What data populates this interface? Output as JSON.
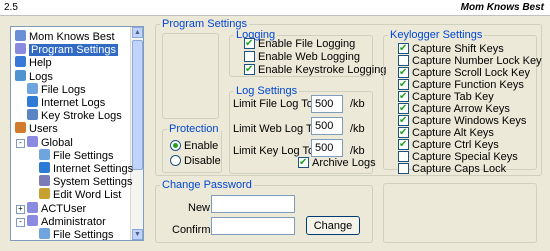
{
  "titlebar": {
    "version": "2.5",
    "app_name": "Mom Knows Best"
  },
  "tree": [
    {
      "label": "Mom Knows Best",
      "indent": 0,
      "icon": "home-icon",
      "color": "#6b8fd6"
    },
    {
      "label": "Program Settings",
      "indent": 0,
      "icon": "gear-icon",
      "color": "#8a8ae0",
      "selected": true
    },
    {
      "label": "Help",
      "indent": 0,
      "icon": "help-icon",
      "color": "#3a78d8"
    },
    {
      "label": "Logs",
      "indent": 0,
      "icon": "logs-icon",
      "color": "#4f93d1"
    },
    {
      "label": "File Logs",
      "indent": 1,
      "icon": "file-logs-icon",
      "color": "#6fa4df"
    },
    {
      "label": "Internet Logs",
      "indent": 1,
      "icon": "globe-icon",
      "color": "#2d7bd5"
    },
    {
      "label": "Key Stroke Logs",
      "indent": 1,
      "icon": "keyboard-icon",
      "color": "#5a87c4"
    },
    {
      "label": "Users",
      "indent": 0,
      "icon": "users-icon",
      "color": "#d07c2c"
    },
    {
      "label": "Global",
      "indent": 1,
      "icon": "gear-icon",
      "color": "#8a8ae0",
      "expander": "-"
    },
    {
      "label": "File Settings",
      "indent": 2,
      "icon": "file-settings-icon",
      "color": "#6fa4df"
    },
    {
      "label": "Internet Settings",
      "indent": 2,
      "icon": "globe-icon",
      "color": "#2d7bd5"
    },
    {
      "label": "System Settings",
      "indent": 2,
      "icon": "system-settings-icon",
      "color": "#7b7bb8"
    },
    {
      "label": "Edit Word List",
      "indent": 2,
      "icon": "pencil-icon",
      "color": "#c8a030"
    },
    {
      "label": "ACTUser",
      "indent": 1,
      "icon": "gear-icon",
      "color": "#8a8ae0",
      "expander": "+"
    },
    {
      "label": "Administrator",
      "indent": 1,
      "icon": "gear-icon",
      "color": "#8a8ae0",
      "expander": "-"
    },
    {
      "label": "File Settings",
      "indent": 2,
      "icon": "file-settings-icon",
      "color": "#6fa4df"
    }
  ],
  "program_settings": {
    "title": "Program Settings"
  },
  "logging": {
    "title": "Logging",
    "items": [
      {
        "label": "Enable File Logging",
        "checked": true
      },
      {
        "label": "Enable Web Logging",
        "checked": false
      },
      {
        "label": "Enable Keystroke Logging",
        "checked": true
      }
    ]
  },
  "log_settings": {
    "title": "Log Settings",
    "file_label": "Limit File Log To:",
    "file_value": "500",
    "file_unit": "/kb",
    "web_label": "Limit Web Log To:",
    "web_value": "500",
    "web_unit": "/kb",
    "key_label": "Limit Key Log To:",
    "key_value": "500",
    "key_unit": "/kb",
    "archive_label": "Archive Logs",
    "archive_checked": true
  },
  "protection": {
    "title": "Protection",
    "enable_label": "Enable",
    "disable_label": "Disable",
    "selected": "enable"
  },
  "keylogger": {
    "title": "Keylogger Settings",
    "items": [
      {
        "label": "Capture Shift Keys",
        "checked": true
      },
      {
        "label": "Capture Number Lock Key",
        "checked": false
      },
      {
        "label": "Capture Scroll Lock Key",
        "checked": true
      },
      {
        "label": "Capture Function Keys",
        "checked": true
      },
      {
        "label": "Capture Tab Key",
        "checked": true
      },
      {
        "label": "Capture Arrow Keys",
        "checked": true
      },
      {
        "label": "Capture Windows Keys",
        "checked": true
      },
      {
        "label": "Capture Alt Keys",
        "checked": true
      },
      {
        "label": "Capture Ctrl Keys",
        "checked": true
      },
      {
        "label": "Capture Special Keys",
        "checked": false
      },
      {
        "label": "Capture Caps Lock",
        "checked": false
      }
    ]
  },
  "change_password": {
    "title": "Change Password",
    "new_label": "New:",
    "new_value": "",
    "confirm_label": "Confirm:",
    "confirm_value": "",
    "button_label": "Change"
  }
}
